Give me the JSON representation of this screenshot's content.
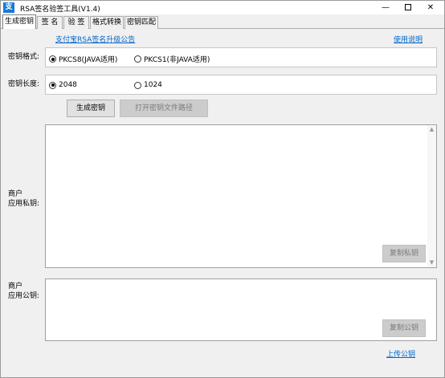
{
  "window": {
    "title": "RSA签名验签工具(V1.4)",
    "icon_char": "支",
    "minimize": "—",
    "close": "✕"
  },
  "tabs": [
    {
      "label": "生成密钥",
      "active": true
    },
    {
      "label": "签 名",
      "active": false
    },
    {
      "label": "验 签",
      "active": false
    },
    {
      "label": "格式转换",
      "active": false
    },
    {
      "label": "密钥匹配",
      "active": false
    }
  ],
  "links": {
    "announcement": "支付宝RSA签名升级公告",
    "help": "使用说明",
    "upload_public_key": "上传公钥"
  },
  "key_format": {
    "label": "密钥格式:",
    "options": [
      "PKCS8(JAVA适用)",
      "PKCS1(非JAVA适用)"
    ],
    "selected": "PKCS8(JAVA适用)"
  },
  "key_length": {
    "label": "密钥长度:",
    "options": [
      "2048",
      "1024"
    ],
    "selected": "2048"
  },
  "buttons": {
    "generate": "生成密钥",
    "open_path": "打开密钥文件路径",
    "copy_private": "复制私钥",
    "copy_public": "复制公钥"
  },
  "private_key": {
    "label_line1": "商户",
    "label_line2": "应用私钥:",
    "value": ""
  },
  "public_key": {
    "label_line1": "商户",
    "label_line2": "应用公钥:",
    "value": ""
  }
}
